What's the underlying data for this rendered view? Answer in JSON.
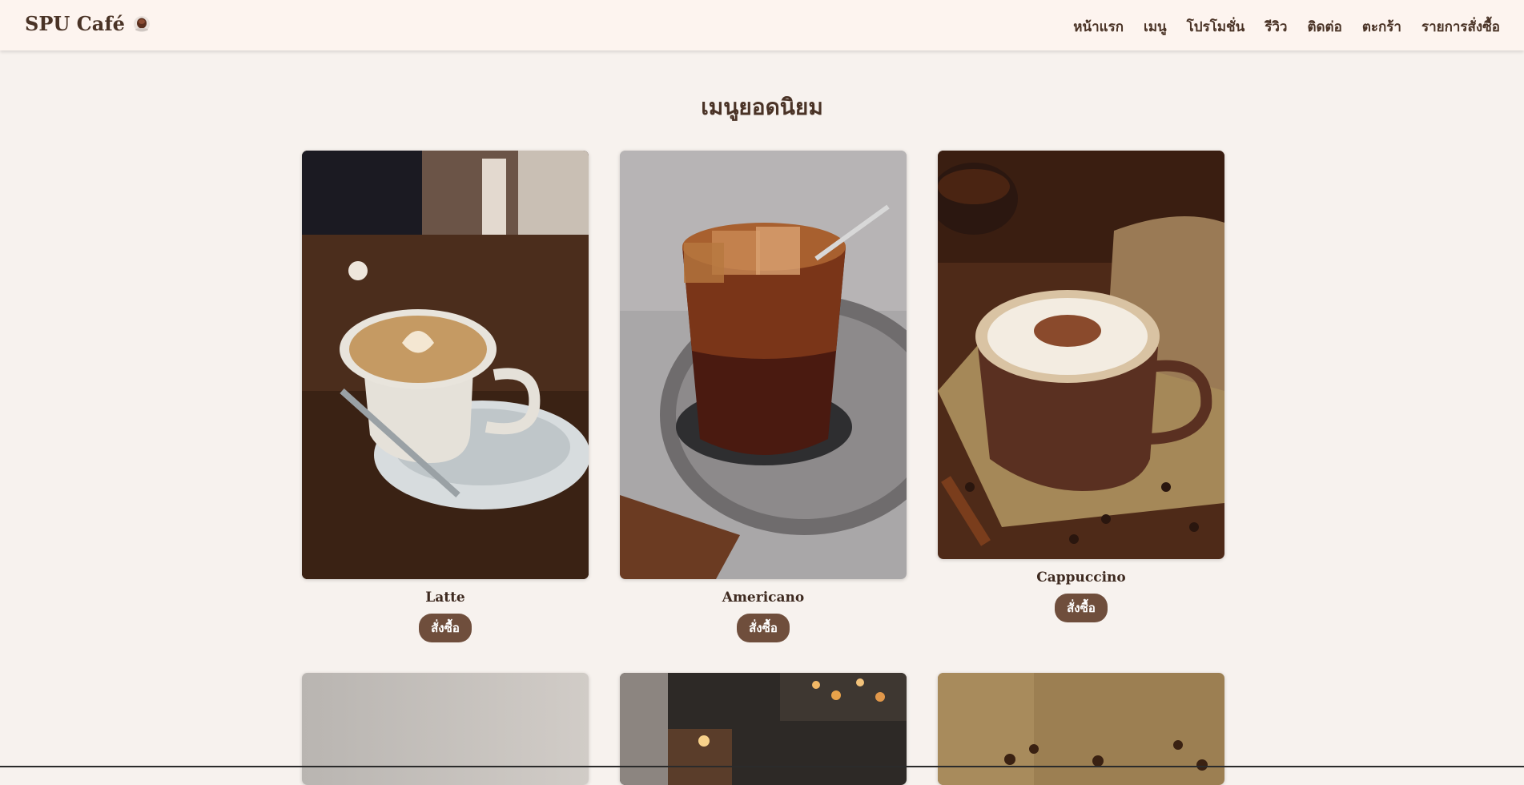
{
  "brand": {
    "name": "SPU Café",
    "icon": "coffee-cup-icon"
  },
  "nav": {
    "items": [
      {
        "label": "หน้าแรก"
      },
      {
        "label": "เมนู"
      },
      {
        "label": "โปรโมชั่น"
      },
      {
        "label": "รีวิว"
      },
      {
        "label": "ติดต่อ"
      },
      {
        "label": "ตะกร้า"
      },
      {
        "label": "รายการสั่งซื้อ"
      }
    ]
  },
  "section": {
    "title": "เมนูยอดนิยม"
  },
  "products": [
    {
      "name": "Latte",
      "button": "สั่งซื้อ",
      "image": "latte-photo"
    },
    {
      "name": "Americano",
      "button": "สั่งซื้อ",
      "image": "iced-americano-photo"
    },
    {
      "name": "Cappuccino",
      "button": "สั่งซื้อ",
      "image": "cappuccino-photo"
    },
    {
      "image": "product-photo-4"
    },
    {
      "image": "product-photo-5"
    },
    {
      "image": "product-photo-6"
    }
  ],
  "colors": {
    "accent": "#6f4e3c",
    "background": "#f7f2ee",
    "navbar": "#fdf4ef",
    "text": "#4a3326"
  }
}
